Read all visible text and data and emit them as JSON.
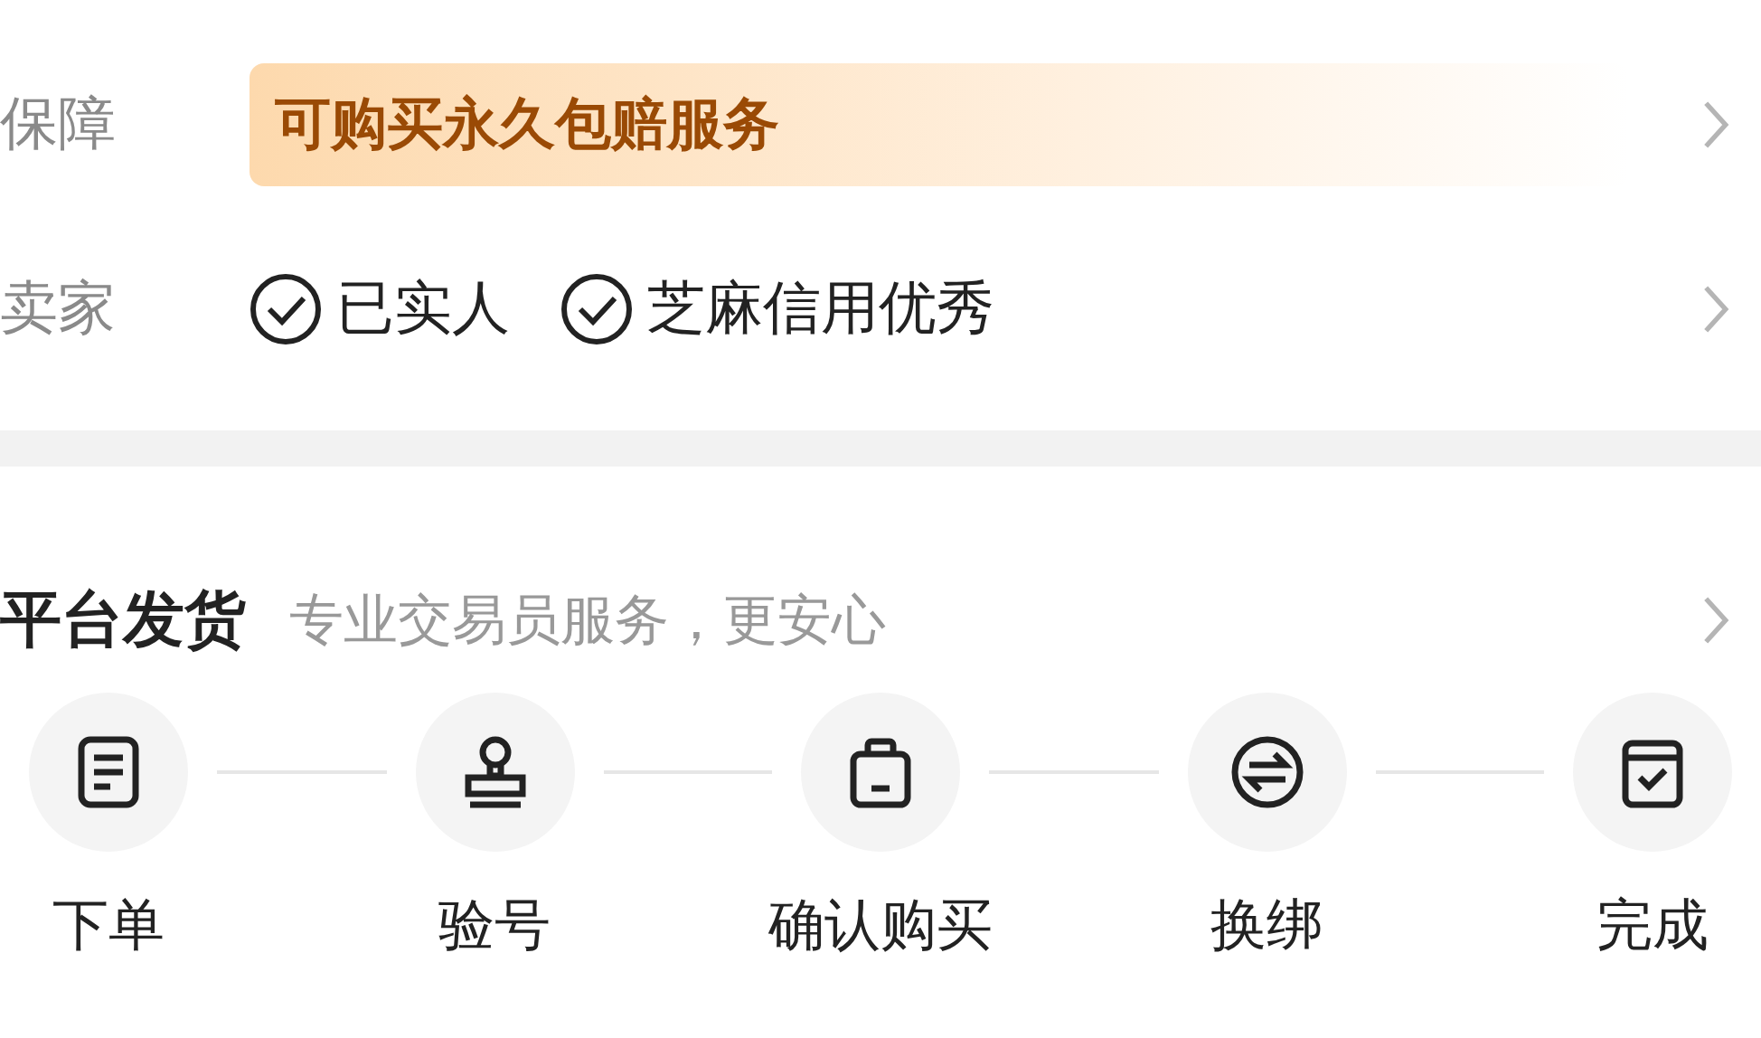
{
  "guarantee": {
    "label": "保障",
    "text": "可购买永久包赔服务"
  },
  "seller": {
    "label": "卖家",
    "badges": [
      "已实人",
      "芝麻信用优秀"
    ]
  },
  "platform": {
    "title": "平台发货",
    "subtitle": "专业交易员服务，更安心",
    "steps": [
      {
        "kind": "order",
        "label": "下单"
      },
      {
        "kind": "verify",
        "label": "验号"
      },
      {
        "kind": "buy",
        "label": "确认购买"
      },
      {
        "kind": "swap",
        "label": "换绑"
      },
      {
        "kind": "done",
        "label": "完成"
      }
    ]
  }
}
